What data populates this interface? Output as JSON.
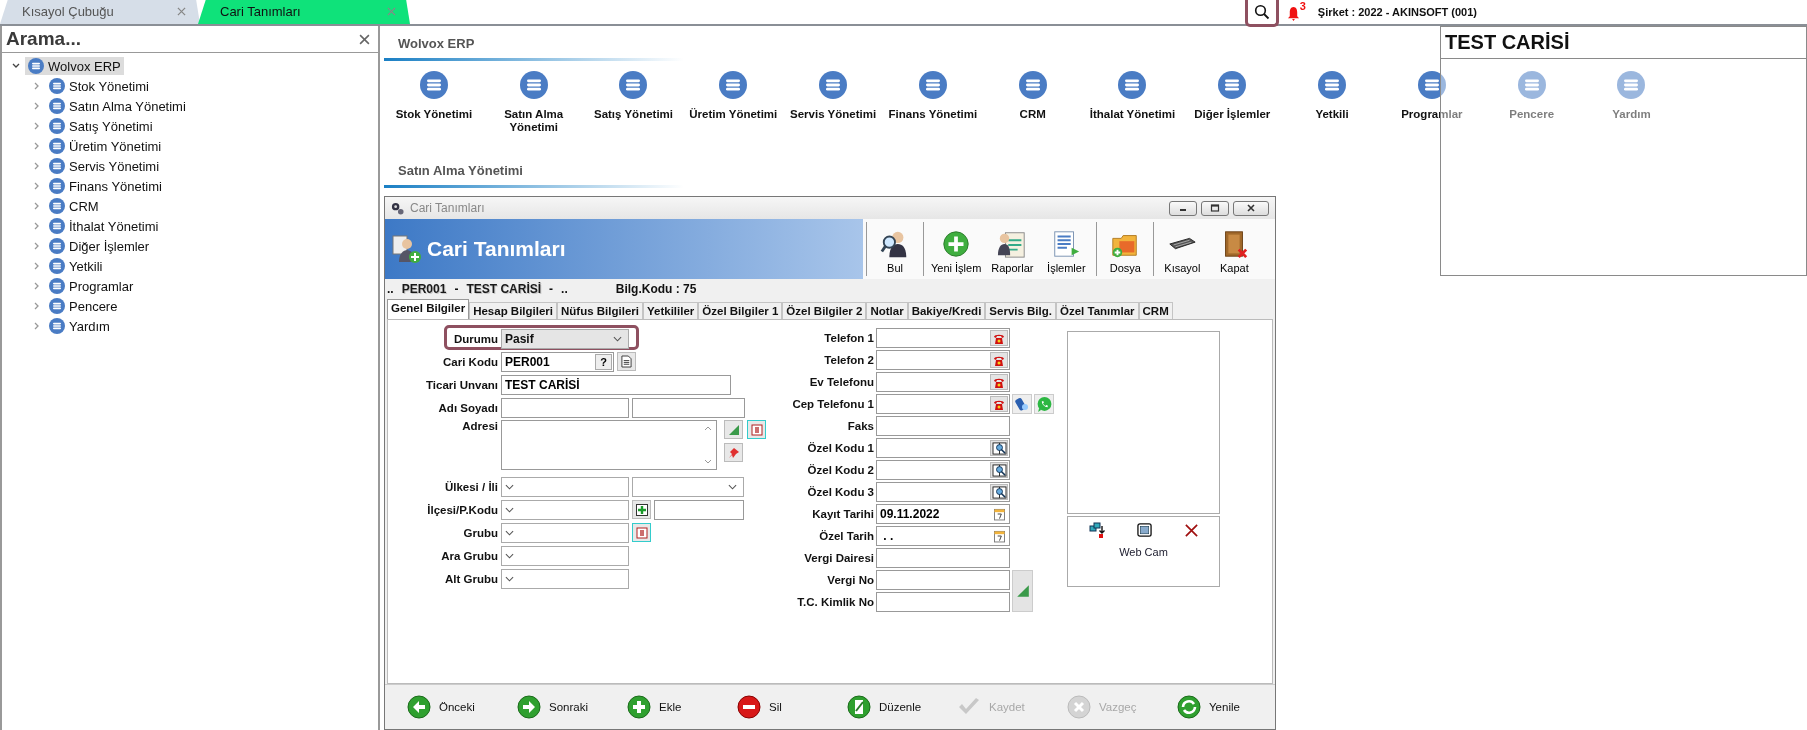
{
  "doc_tabs": [
    {
      "label": "Kısayol Çubuğu",
      "selected": false
    },
    {
      "label": "Cari Tanımları",
      "selected": true
    }
  ],
  "top_right": {
    "notification_count": "3",
    "company": "Şirket : 2022 - AKINSOFT (001)"
  },
  "search_panel": {
    "placeholder": "Arama..."
  },
  "tree": {
    "label": "Wolvox ERP",
    "expanded": true,
    "selected": true,
    "children": [
      {
        "label": "Stok Yönetimi",
        "expanded": false
      },
      {
        "label": "Satın Alma Yönetimi",
        "expanded": false
      },
      {
        "label": "Satış Yönetimi",
        "expanded": false
      },
      {
        "label": "Üretim Yönetimi",
        "expanded": false
      },
      {
        "label": "Servis Yönetimi",
        "expanded": false
      },
      {
        "label": "Finans Yönetimi",
        "expanded": false
      },
      {
        "label": "CRM",
        "expanded": false
      },
      {
        "label": "İthalat Yönetimi",
        "expanded": false
      },
      {
        "label": "Diğer İşlemler",
        "expanded": false
      },
      {
        "label": "Yetkili",
        "expanded": false
      },
      {
        "label": "Programlar",
        "expanded": false
      },
      {
        "label": "Pencere",
        "expanded": false
      },
      {
        "label": "Yardım",
        "expanded": false
      }
    ]
  },
  "module_sections": [
    {
      "title": "Wolvox ERP",
      "modules": [
        "Stok Yönetimi",
        "Satın Alma Yönetimi",
        "Satış Yönetimi",
        "Üretim Yönetimi",
        "Servis Yönetimi",
        "Finans Yönetimi",
        "CRM",
        "İthalat Yönetimi",
        "Diğer İşlemler",
        "Yetkili",
        "Programlar",
        "Pencere",
        "Yardım"
      ]
    },
    {
      "title": "Satın Alma Yönetimi"
    }
  ],
  "popup": {
    "title": "TEST CARİSİ"
  },
  "dialog": {
    "window_title": "Cari Tanımları",
    "banner_title": "Cari Tanımları",
    "toolbar": [
      {
        "label": "Bul",
        "separator_before": true
      },
      {
        "label": "Yeni İşlem",
        "separator_before": true
      },
      {
        "label": "Raporlar",
        "separator_before": false
      },
      {
        "label": "İşlemler",
        "separator_before": false
      },
      {
        "label": "Dosya",
        "separator_before": true
      },
      {
        "label": "Kısayol",
        "separator_before": true
      },
      {
        "label": "Kapat",
        "separator_before": false
      }
    ],
    "info_line": [
      {
        "text": "..",
        "kind": "plain"
      },
      {
        "text": "PER001",
        "kind": "outlined"
      },
      {
        "text": "-",
        "kind": "plain"
      },
      {
        "text": "TEST CARİSİ",
        "kind": "outlined"
      },
      {
        "text": "-",
        "kind": "plain"
      },
      {
        "text": "..",
        "kind": "plain"
      },
      {
        "text": "Bilg.Kodu : 75",
        "kind": "plain"
      }
    ],
    "tabs": [
      {
        "label": "Genel Bilgiler",
        "selected": true
      },
      {
        "label": "Hesap Bilgileri",
        "selected": false
      },
      {
        "label": "Nüfus Bilgileri",
        "selected": false
      },
      {
        "label": "Yetkililer",
        "selected": false
      },
      {
        "label": "Özel Bilgiler 1",
        "selected": false
      },
      {
        "label": "Özel Bilgiler 2",
        "selected": false
      },
      {
        "label": "Notlar",
        "selected": false
      },
      {
        "label": "Bakiye/Kredi",
        "selected": false
      },
      {
        "label": "Servis Bilg.",
        "selected": false
      },
      {
        "label": "Özel Tanımlar",
        "selected": false
      },
      {
        "label": "CRM",
        "selected": false
      }
    ],
    "left_fields": [
      {
        "label": "Durumu",
        "kind": "select",
        "value": "Pasif",
        "highlighted": true
      },
      {
        "label": "Cari Kodu",
        "kind": "code",
        "value": "PER001",
        "help_label": "?",
        "highlighted": false
      },
      {
        "label": "Ticari Unvanı",
        "kind": "text",
        "value": "TEST CARİSİ",
        "highlighted": false
      },
      {
        "label": "Adı Soyadı",
        "kind": "split_text",
        "highlighted": false
      },
      {
        "label": "Adresi",
        "kind": "memo",
        "highlighted": false
      },
      {
        "label": "Ülkesi / İli",
        "kind": "split_select",
        "highlighted": false
      },
      {
        "label": "İlçesi/P.Kodu",
        "kind": "select_add_text",
        "highlighted": false
      },
      {
        "label": "Grubu",
        "kind": "select_button",
        "highlighted": false
      },
      {
        "label": "Ara Grubu",
        "kind": "select",
        "highlighted": false
      },
      {
        "label": "Alt Grubu",
        "kind": "select",
        "highlighted": false
      }
    ],
    "middle_fields": [
      {
        "label": "Telefon 1",
        "kind": "phone"
      },
      {
        "label": "Telefon 2",
        "kind": "phone"
      },
      {
        "label": "Ev Telefonu",
        "kind": "phone"
      },
      {
        "label": "Cep Telefonu 1",
        "kind": "mobile"
      },
      {
        "label": "Faks",
        "kind": "text"
      },
      {
        "label": "Özel Kodu 1",
        "kind": "lookup"
      },
      {
        "label": "Özel Kodu 2",
        "kind": "lookup"
      },
      {
        "label": "Özel Kodu 3",
        "kind": "lookup"
      },
      {
        "label": "Kayıt Tarihi",
        "kind": "date",
        "value": "09.11.2022"
      },
      {
        "label": "Özel Tarih",
        "kind": "date",
        "value": " . ."
      },
      {
        "label": "Vergi Dairesi",
        "kind": "text"
      },
      {
        "label": "Vergi No",
        "kind": "tax"
      },
      {
        "label": "T.C. Kimlik No",
        "kind": "tax"
      }
    ],
    "photo": {
      "webcam_label": "Web Cam"
    },
    "bottom_buttons": [
      {
        "label": "Önceki",
        "disabled": false
      },
      {
        "label": "Sonraki",
        "disabled": false
      },
      {
        "label": "Ekle",
        "disabled": false
      },
      {
        "label": "Sil",
        "disabled": false
      },
      {
        "label": "Düzenle",
        "disabled": false
      },
      {
        "label": "Kaydet",
        "disabled": true
      },
      {
        "label": "Vazgeç",
        "disabled": true
      },
      {
        "label": "Yenile",
        "disabled": false
      }
    ]
  }
}
